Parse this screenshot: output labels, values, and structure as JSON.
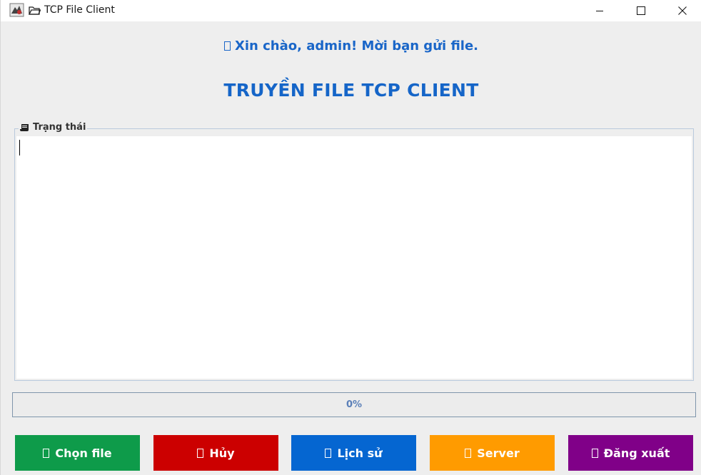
{
  "window": {
    "title": "TCP File Client",
    "minimize_icon": "minimize-icon",
    "maximize_icon": "maximize-icon",
    "close_icon": "close-icon"
  },
  "header": {
    "greeting": "Xin chào, admin! Mời bạn gửi file.",
    "title": "TRUYỀN FILE TCP CLIENT"
  },
  "status": {
    "legend": "Trạng thái",
    "icon": "scroll-icon",
    "content": ""
  },
  "progress": {
    "value": 0,
    "label": "0%"
  },
  "buttons": {
    "choose_file": "Chọn file",
    "cancel": "Hủy",
    "history": "Lịch sử",
    "server": "Server",
    "logout": "Đăng xuất"
  },
  "colors": {
    "title_blue": "#1565c8",
    "choose": "#0e9b4a",
    "cancel": "#cc0000",
    "history": "#0566d1",
    "server": "#ff9b00",
    "logout": "#800088"
  }
}
